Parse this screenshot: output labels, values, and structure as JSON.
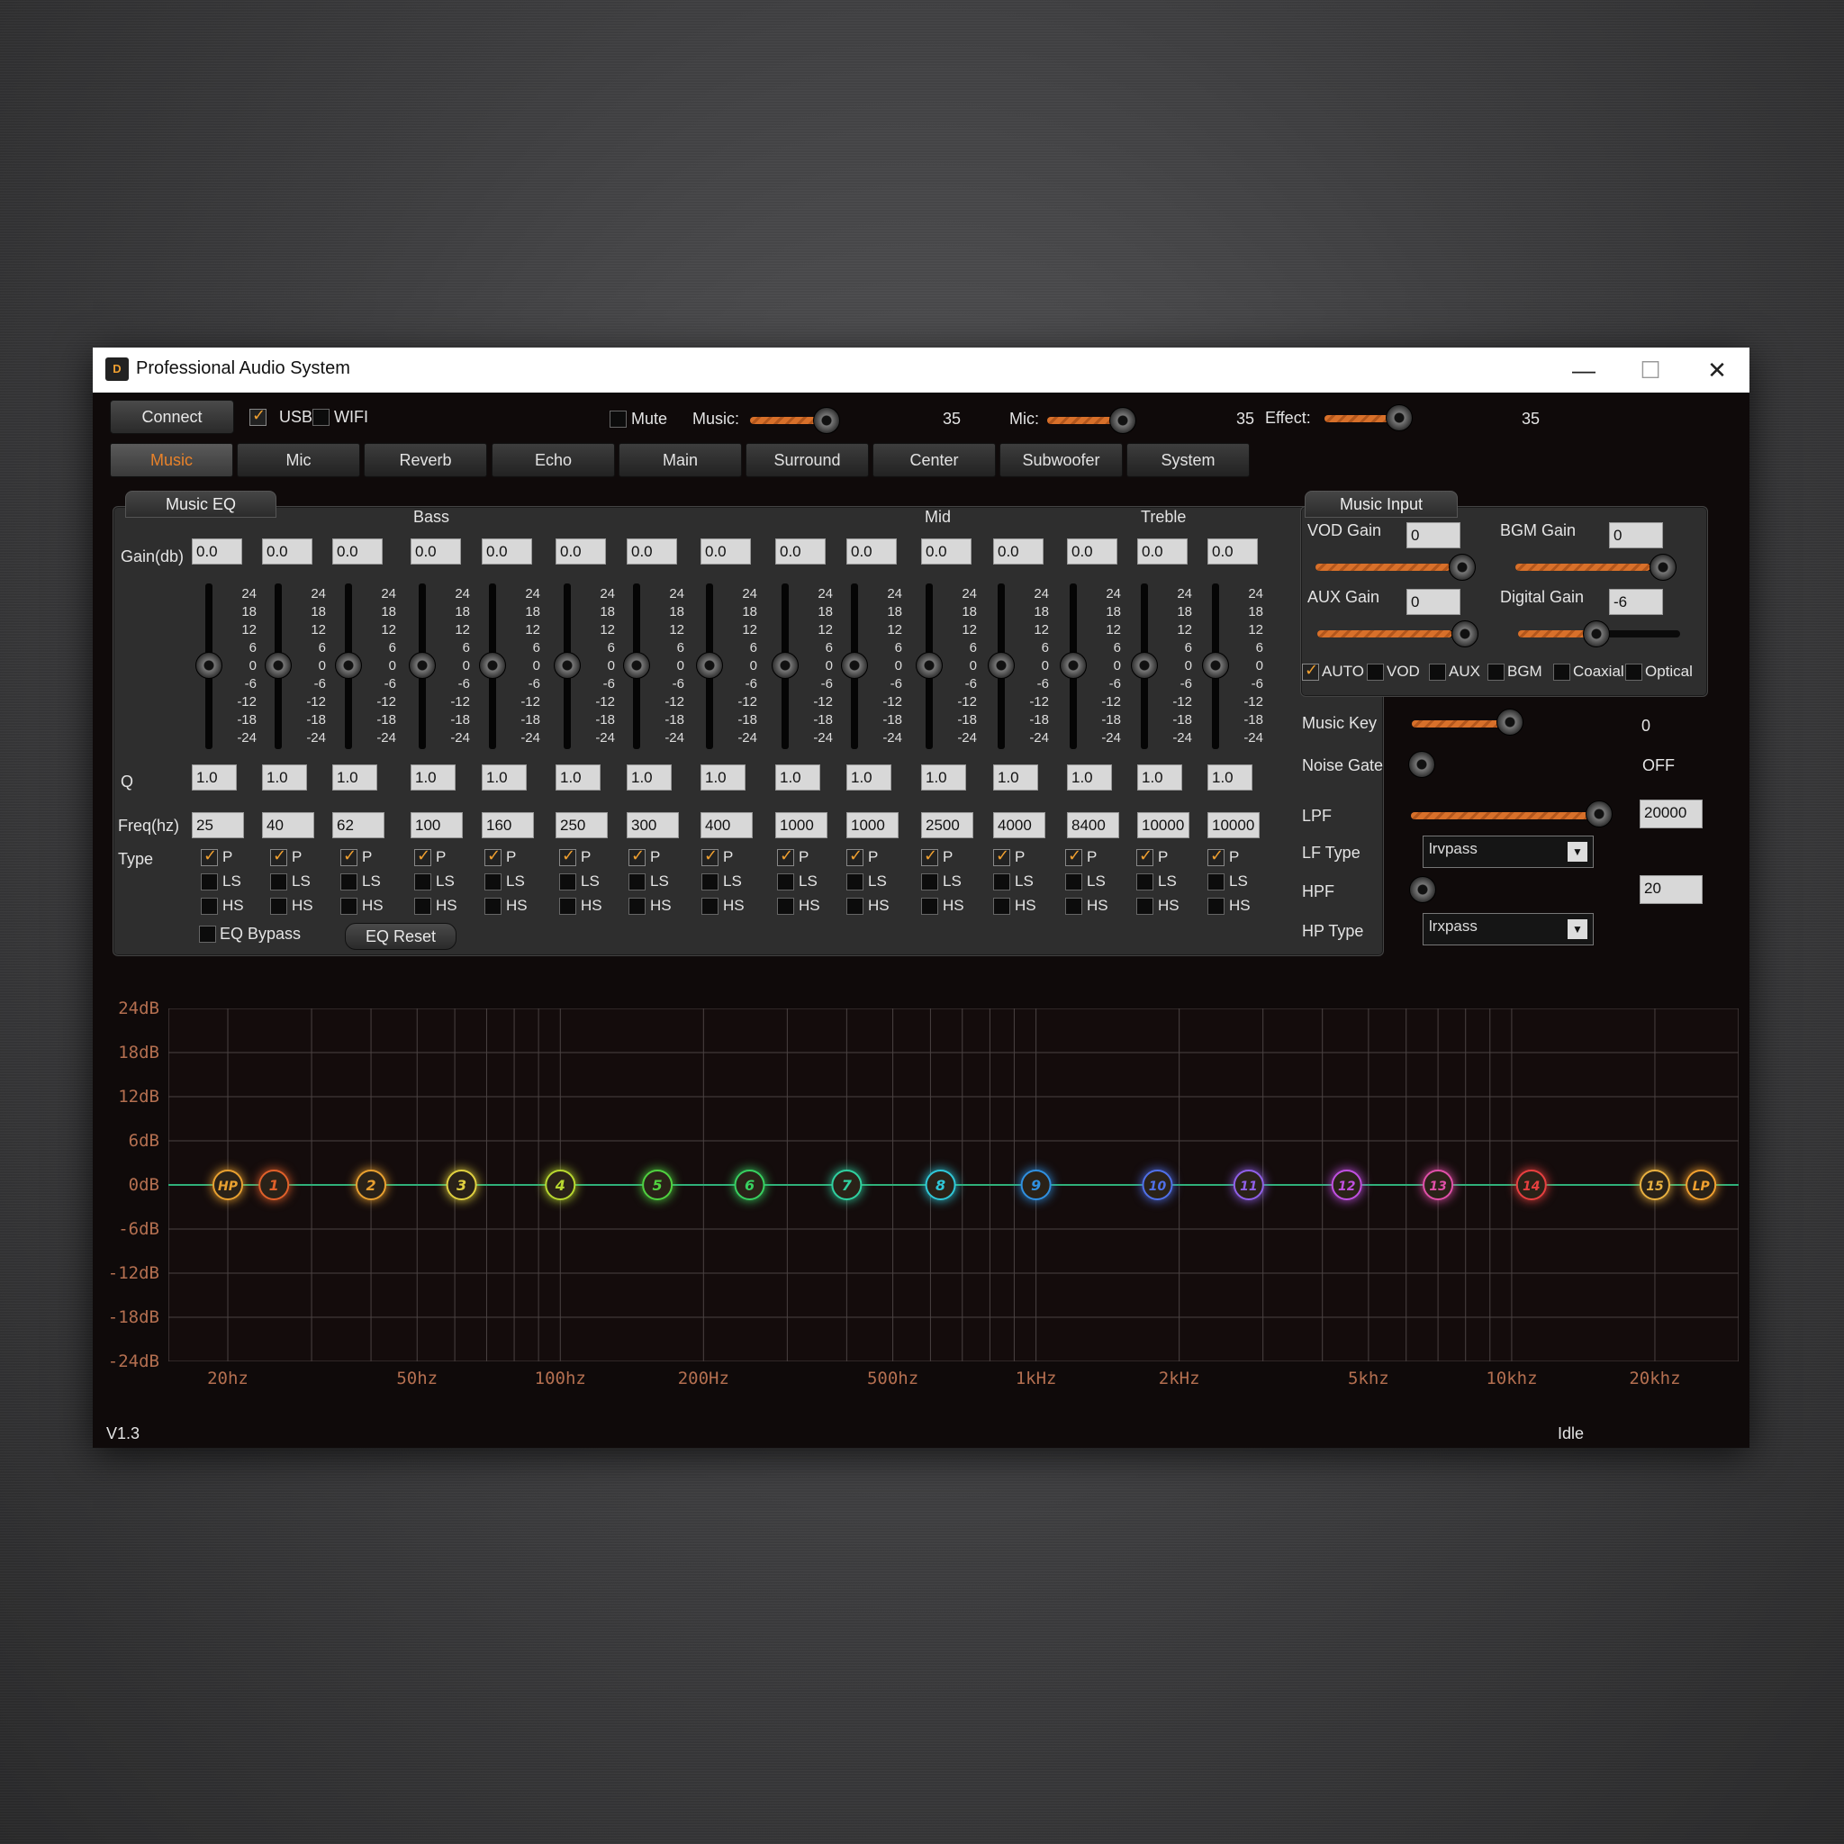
{
  "window": {
    "title": "Professional Audio System",
    "logo": "D",
    "controls": {
      "minimize": "—",
      "maximize": "☐",
      "close": "✕"
    }
  },
  "toolbar": {
    "connect_label": "Connect",
    "usb_label": "USB",
    "usb_checked": true,
    "wifi_label": "WIFI",
    "wifi_checked": false,
    "mute_label": "Mute",
    "mute_checked": false,
    "music_label": "Music:",
    "music_value": "35",
    "mic_label": "Mic:",
    "mic_value": "35",
    "effect_label": "Effect:",
    "effect_value": "35"
  },
  "tabs": [
    {
      "label": "Music",
      "active": true
    },
    {
      "label": "Mic"
    },
    {
      "label": "Reverb"
    },
    {
      "label": "Echo"
    },
    {
      "label": "Main"
    },
    {
      "label": "Surround"
    },
    {
      "label": "Center"
    },
    {
      "label": "Subwoofer"
    },
    {
      "label": "System"
    }
  ],
  "eq": {
    "title": "Music EQ",
    "group_labels": {
      "bass": "Bass",
      "mid": "Mid",
      "treble": "Treble"
    },
    "row_labels": {
      "gain": "Gain(db)",
      "q": "Q",
      "freq": "Freq(hz)",
      "type": "Type"
    },
    "scale": [
      "24",
      "18",
      "12",
      "6",
      "0",
      "-6",
      "-12",
      "-18",
      "-24"
    ],
    "type_options": [
      "P",
      "LS",
      "HS"
    ],
    "bands": [
      {
        "gain": "0.0",
        "q": "1.0",
        "freq": "25"
      },
      {
        "gain": "0.0",
        "q": "1.0",
        "freq": "40"
      },
      {
        "gain": "0.0",
        "q": "1.0",
        "freq": "62"
      },
      {
        "gain": "0.0",
        "q": "1.0",
        "freq": "100"
      },
      {
        "gain": "0.0",
        "q": "1.0",
        "freq": "160"
      },
      {
        "gain": "0.0",
        "q": "1.0",
        "freq": "250"
      },
      {
        "gain": "0.0",
        "q": "1.0",
        "freq": "300"
      },
      {
        "gain": "0.0",
        "q": "1.0",
        "freq": "400"
      },
      {
        "gain": "0.0",
        "q": "1.0",
        "freq": "1000"
      },
      {
        "gain": "0.0",
        "q": "1.0",
        "freq": "1000"
      },
      {
        "gain": "0.0",
        "q": "1.0",
        "freq": "2500"
      },
      {
        "gain": "0.0",
        "q": "1.0",
        "freq": "4000"
      },
      {
        "gain": "0.0",
        "q": "1.0",
        "freq": "8400"
      },
      {
        "gain": "0.0",
        "q": "1.0",
        "freq": "10000"
      },
      {
        "gain": "0.0",
        "q": "1.0",
        "freq": "10000"
      }
    ],
    "bypass_label": "EQ Bypass",
    "reset_label": "EQ Reset"
  },
  "music_input": {
    "title": "Music Input",
    "vod_gain_label": "VOD Gain",
    "vod_gain": "0",
    "bgm_gain_label": "BGM Gain",
    "bgm_gain": "0",
    "aux_gain_label": "AUX Gain",
    "aux_gain": "0",
    "digital_gain_label": "Digital Gain",
    "digital_gain": "-6",
    "sources": [
      {
        "label": "AUTO",
        "checked": true
      },
      {
        "label": "VOD",
        "checked": false
      },
      {
        "label": "AUX",
        "checked": false
      },
      {
        "label": "BGM",
        "checked": false
      },
      {
        "label": "Coaxial",
        "checked": false
      },
      {
        "label": "Optical",
        "checked": false
      }
    ]
  },
  "right_controls": {
    "music_key_label": "Music Key",
    "music_key_value": "0",
    "noise_gate_label": "Noise Gate",
    "noise_gate_value": "OFF",
    "lpf_label": "LPF",
    "lpf_value": "20000",
    "lf_type_label": "LF Type",
    "lf_type_value": "lrvpass",
    "hpf_label": "HPF",
    "hpf_value": "20",
    "hp_type_label": "HP Type",
    "hp_type_value": "lrxpass"
  },
  "chart_data": {
    "type": "line",
    "y_tick_labels": [
      "24dB",
      "18dB",
      "12dB",
      "6dB",
      "0dB",
      "-6dB",
      "-12dB",
      "-18dB",
      "-24dB"
    ],
    "x_tick_labels": [
      {
        "label": "20hz",
        "freq": 20
      },
      {
        "label": "50hz",
        "freq": 50
      },
      {
        "label": "100hz",
        "freq": 100
      },
      {
        "label": "200Hz",
        "freq": 200
      },
      {
        "label": "500hz",
        "freq": 500
      },
      {
        "label": "1kHz",
        "freq": 1000
      },
      {
        "label": "2kHz",
        "freq": 2000
      },
      {
        "label": "5khz",
        "freq": 5000
      },
      {
        "label": "10khz",
        "freq": 10000
      },
      {
        "label": "20khz",
        "freq": 20000
      }
    ],
    "ylim": [
      -24,
      24
    ],
    "xlim_hz": [
      15,
      30000
    ],
    "x_scale": "log",
    "grid": true,
    "curve_gain_db": 0,
    "points": [
      {
        "label": "HP",
        "freq": 20,
        "gain": 0,
        "color": "#e8a030"
      },
      {
        "label": "1",
        "freq": 25,
        "gain": 0,
        "color": "#e0602a"
      },
      {
        "label": "2",
        "freq": 40,
        "gain": 0,
        "color": "#e8a030"
      },
      {
        "label": "3",
        "freq": 62,
        "gain": 0,
        "color": "#e0d040"
      },
      {
        "label": "4",
        "freq": 100,
        "gain": 0,
        "color": "#b8d830"
      },
      {
        "label": "5",
        "freq": 160,
        "gain": 0,
        "color": "#50d040"
      },
      {
        "label": "6",
        "freq": 250,
        "gain": 0,
        "color": "#38d060"
      },
      {
        "label": "7",
        "freq": 400,
        "gain": 0,
        "color": "#30d0a0"
      },
      {
        "label": "8",
        "freq": 630,
        "gain": 0,
        "color": "#30c8d8"
      },
      {
        "label": "9",
        "freq": 1000,
        "gain": 0,
        "color": "#3090e0"
      },
      {
        "label": "10",
        "freq": 1800,
        "gain": 0,
        "color": "#5070e8"
      },
      {
        "label": "11",
        "freq": 2800,
        "gain": 0,
        "color": "#9060e8"
      },
      {
        "label": "12",
        "freq": 4500,
        "gain": 0,
        "color": "#c050e0"
      },
      {
        "label": "13",
        "freq": 7000,
        "gain": 0,
        "color": "#e050a8"
      },
      {
        "label": "14",
        "freq": 11000,
        "gain": 0,
        "color": "#e84040"
      },
      {
        "label": "15",
        "freq": 20000,
        "gain": 0,
        "color": "#e8b040"
      },
      {
        "label": "LP",
        "freq": 25000,
        "gain": 0,
        "color": "#f0a030"
      }
    ],
    "curve_color": "#2fb07a"
  },
  "status": {
    "version": "V1.3",
    "state": "Idle"
  }
}
